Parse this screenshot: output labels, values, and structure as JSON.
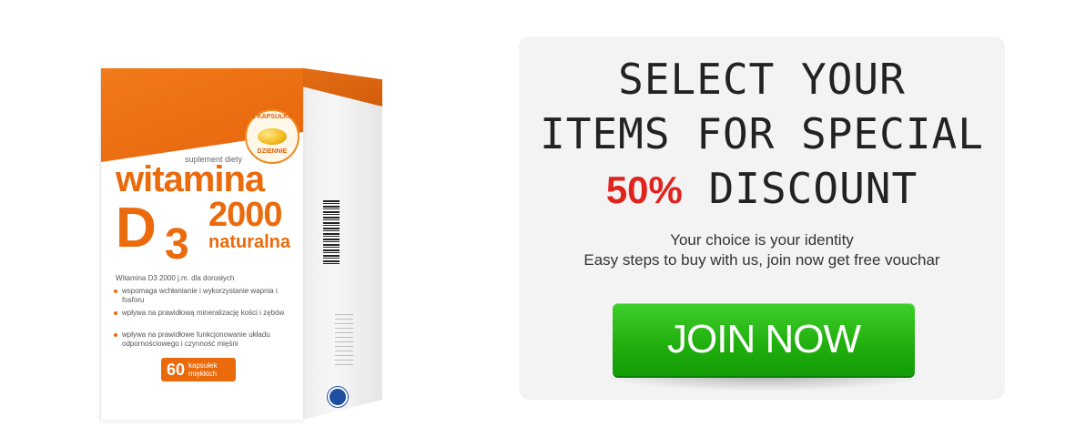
{
  "product": {
    "badge_top": "1 KAPSUŁKA",
    "badge_bottom": "DZIENNIE",
    "supplement": "suplement diety",
    "title": "witamina",
    "d_letter": "D",
    "d_sub": "3",
    "strength": "2000",
    "variant": "naturalna",
    "description": "Witamina D3 2000 j.m. dla dorosłych",
    "bullets": [
      "wspomaga wchłanianie i wykorzystanie wapnia i fosforu",
      "wpływa na prawidłową mineralizację kości i zębów",
      "wpływa na prawidłowe funkcjonowanie układu odpornościowego i czynność mięśni"
    ],
    "count": "60",
    "count_label": "kapsułek miękkich"
  },
  "promo": {
    "line1": "SELECT YOUR",
    "line2": "ITEMS FOR SPECIAL",
    "percent": "50%",
    "line3": "DISCOUNT",
    "tagline1": "Your choice is your identity",
    "tagline2": "Easy steps to buy with us, join now get free vouchar",
    "button_label": "JOIN NOW"
  },
  "colors": {
    "accent_red": "#e0231d",
    "button_green": "#22b00f",
    "product_orange": "#ea6a0c",
    "panel_bg": "#f3f3f3"
  },
  "icons": [
    "barcode-icon",
    "capsule-icon",
    "seal-icon"
  ]
}
